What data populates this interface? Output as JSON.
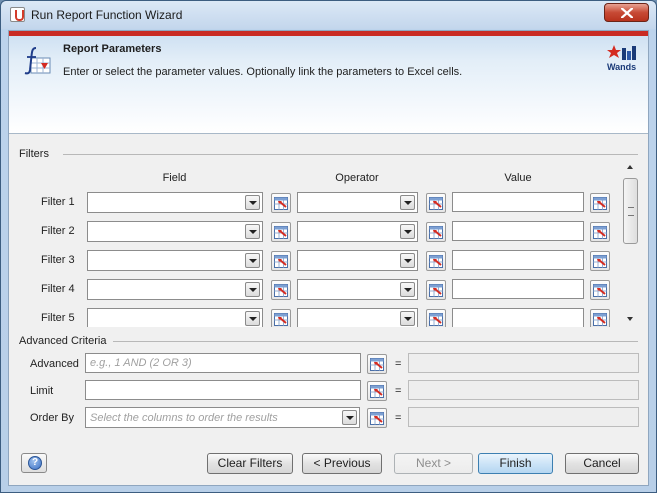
{
  "window": {
    "title": "Run Report Function Wizard"
  },
  "banner": {
    "title": "Report Parameters",
    "description": "Enter or select the parameter values. Optionally link the parameters to Excel cells.",
    "logo_text": "Wands"
  },
  "filters": {
    "section_label": "Filters",
    "columns": {
      "field": "Field",
      "operator": "Operator",
      "value": "Value"
    },
    "rows": [
      {
        "label": "Filter 1",
        "field": "",
        "operator": "",
        "value": ""
      },
      {
        "label": "Filter 2",
        "field": "",
        "operator": "",
        "value": ""
      },
      {
        "label": "Filter 3",
        "field": "",
        "operator": "",
        "value": ""
      },
      {
        "label": "Filter 4",
        "field": "",
        "operator": "",
        "value": ""
      },
      {
        "label": "Filter 5",
        "field": "",
        "operator": "",
        "value": ""
      }
    ]
  },
  "advanced_criteria": {
    "section_label": "Advanced Criteria",
    "advanced": {
      "label": "Advanced",
      "value": "",
      "placeholder": "e.g., 1 AND (2 OR 3)",
      "linked": ""
    },
    "limit": {
      "label": "Limit",
      "value": "",
      "linked": ""
    },
    "order_by": {
      "label": "Order By",
      "placeholder": "Select the columns to order the results",
      "linked": ""
    },
    "equals_sign": "="
  },
  "buttons": {
    "clear_filters": "Clear Filters",
    "previous": "< Previous",
    "next": "Next >",
    "finish": "Finish",
    "cancel": "Cancel",
    "help": "?"
  },
  "icons": {
    "close": "close-icon",
    "app": "java-cup-icon",
    "banner": "function-icon",
    "cell_link": "excel-cell-link-icon",
    "help": "help-icon",
    "logo": "wands-logo"
  },
  "colors": {
    "banner_stripe": "#c92b23",
    "primary_button_border": "#3c7fb1",
    "logo_text": "#1a3a78"
  }
}
